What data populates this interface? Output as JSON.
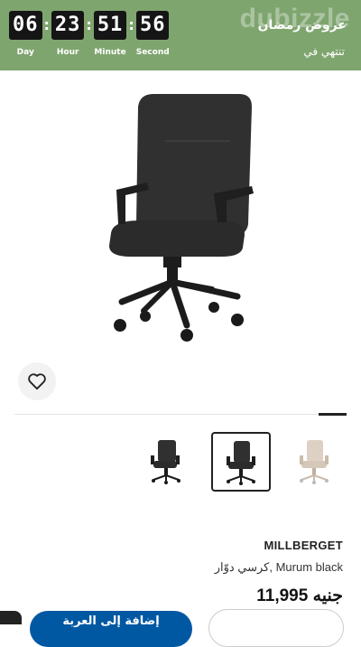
{
  "banner": {
    "bg_color": "#7fa56f",
    "timer": [
      {
        "value": "06",
        "label": "Day"
      },
      {
        "value": "23",
        "label": "Hour"
      },
      {
        "value": "51",
        "label": "Minute"
      },
      {
        "value": "56",
        "label": "Second"
      }
    ],
    "promo_title": "عروض رمضان",
    "ends_label": "تنتهي في",
    "watermark": "dubizzle"
  },
  "product": {
    "brand": "MILLBERGET",
    "description": "كرسي دوّار, Murum black",
    "price": "11,995 جنيه"
  },
  "actions": {
    "add_to_cart": "إضافة إلى العربة"
  },
  "icons": {
    "favorite": "heart-icon"
  },
  "colors": {
    "accent_blue": "#0058a3"
  }
}
